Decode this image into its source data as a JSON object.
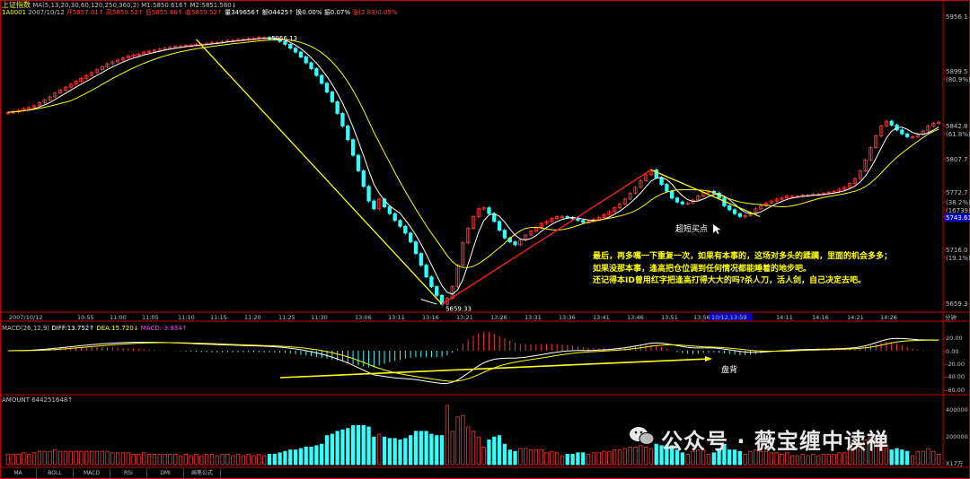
{
  "header": {
    "index_name": "上证指数",
    "ma_line": "MA(5,13,20,30,60,120,250,360,2) M1:5850.616↑ M2:5851.580↓",
    "symbol": "1A0001",
    "date": "2007/10/12",
    "open": "开5857.01↑",
    "high": "高5859.52↑",
    "low": "低5855.60↑",
    "last": "收5859.52↑",
    "volume": "量349656↑",
    "amount": "额04425↑",
    "turnover": "换0.00%",
    "amplitude": "振0.07%",
    "change": "涨(2.83)0.05%"
  },
  "price_axis": [
    {
      "label": "5956.1"
    },
    {
      "label": "5899.5"
    },
    {
      "label": "(80.9%)"
    },
    {
      "label": "5842.8"
    },
    {
      "label": "(61.8%)"
    },
    {
      "label": "5807.7"
    },
    {
      "label": "5772.7"
    },
    {
      "label": "(38.2%)"
    },
    {
      "label": "(16739)"
    },
    {
      "label": "5743.61"
    },
    {
      "label": "5716.0"
    },
    {
      "label": "(19.1%)"
    },
    {
      "label": "5659.3"
    }
  ],
  "time_axis": [
    "2007/10/12",
    "10:55",
    "11:00",
    "11:05",
    "11:10",
    "11:15",
    "11:20",
    "11:25",
    "11:30",
    "13:06",
    "13:11",
    "13:16",
    "13:21",
    "13:26",
    "13:31",
    "13:36",
    "13:41",
    "13:46",
    "13:51",
    "13:56",
    "10/12,13:59",
    "14:11",
    "14:16",
    "14:21",
    "14:26",
    "分钟"
  ],
  "annotations": {
    "high_label": "5956.13",
    "low_label": "5659.33",
    "buy_point": "超短买点",
    "divergence": "盘背",
    "note_lines": [
      "最后，再多嘴一下重复一次，如果有本事的，这场对多头的蹂躏，里面的机会多多；",
      "如果没那本事，逢高把仓位调到任何情况都能睡着的地步吧。",
      "还记得本ID曾用红字把逢高打得大大的吗?杀人刀，活人剑，自己决定去吧。"
    ]
  },
  "macd_header": {
    "title": "MACD(26,12,9)",
    "diff": "DIFF:13.752↑",
    "dea": "DEA:15.720↓",
    "macd": "MACD:-3.934↑"
  },
  "macd_axis": [
    "20.00",
    "0.00",
    "-20.00",
    "-40.00",
    "-60.00"
  ],
  "volume_header": "AMOUNT 644251648↑",
  "volume_axis": [
    "400000",
    "200000"
  ],
  "volume_unit": "X17万",
  "tabs": [
    "MA",
    "BOLL",
    "MACD",
    "RSI",
    "DMI",
    "画笔公式"
  ],
  "watermark": "公众号 · 薇宝缠中读禅",
  "colors": {
    "up": "#ff3333",
    "down": "#33ffff",
    "ma_fast": "#ffffff",
    "ma_slow": "#ffff00",
    "axis": "#c00000",
    "trend": "#ffff00"
  },
  "chart_data": {
    "type": "candlestick",
    "timeframe": "1-minute, 2007-10-12",
    "price_range": [
      5659.3,
      5956.1
    ],
    "closes": [
      5859,
      5860,
      5861,
      5863,
      5864,
      5866,
      5869,
      5872,
      5875,
      5879,
      5882,
      5885,
      5888,
      5891,
      5894,
      5897,
      5900,
      5903,
      5906,
      5909,
      5911,
      5913,
      5915,
      5917,
      5918,
      5919,
      5921,
      5922,
      5923,
      5924,
      5925,
      5926,
      5927,
      5927,
      5928,
      5928,
      5929,
      5929,
      5930,
      5931,
      5931,
      5932,
      5933,
      5933,
      5934,
      5934,
      5935,
      5935,
      5936,
      5936,
      5935,
      5934,
      5932,
      5929,
      5925,
      5921,
      5916,
      5910,
      5904,
      5897,
      5889,
      5880,
      5870,
      5858,
      5845,
      5831,
      5815,
      5799,
      5783,
      5768,
      5760,
      5770,
      5762,
      5755,
      5748,
      5742,
      5735,
      5726,
      5714,
      5702,
      5690,
      5680,
      5671,
      5662,
      5668,
      5680,
      5702,
      5725,
      5740,
      5752,
      5760,
      5761,
      5755,
      5747,
      5738,
      5730,
      5726,
      5723,
      5728,
      5733,
      5737,
      5741,
      5745,
      5747,
      5750,
      5752,
      5752,
      5751,
      5750,
      5748,
      5746,
      5747,
      5749,
      5751,
      5754,
      5757,
      5761,
      5765,
      5770,
      5776,
      5782,
      5789,
      5795,
      5800,
      5792,
      5785,
      5778,
      5771,
      5767,
      5765,
      5766,
      5769,
      5773,
      5777,
      5778,
      5776,
      5771,
      5763,
      5759,
      5755,
      5752,
      5753,
      5756,
      5760,
      5763,
      5766,
      5768,
      5770,
      5771,
      5773,
      5773,
      5773,
      5774,
      5774,
      5775,
      5775,
      5776,
      5777,
      5778,
      5780,
      5782,
      5786,
      5791,
      5799,
      5810,
      5823,
      5835,
      5845,
      5850,
      5846,
      5841,
      5837,
      5834,
      5834,
      5837,
      5840,
      5845,
      5848,
      5849
    ]
  }
}
